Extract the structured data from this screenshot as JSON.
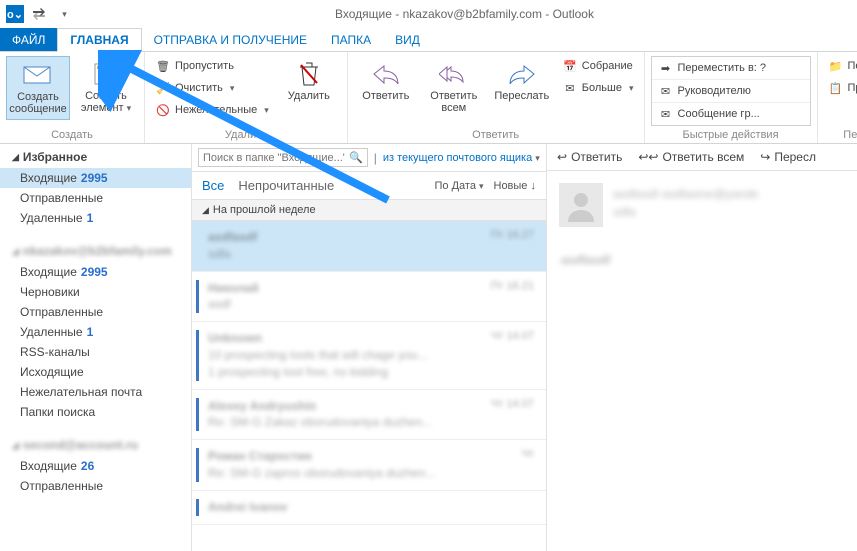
{
  "window": {
    "title": "Входящие - nkazakov@b2bfamily.com - Outlook",
    "app_abbrev": "o⌄"
  },
  "tabs": {
    "file": "ФАЙЛ",
    "home": "ГЛАВНАЯ",
    "sendrecv": "ОТПРАВКА И ПОЛУЧЕНИЕ",
    "folder": "ПАПКА",
    "view": "ВИД"
  },
  "ribbon": {
    "new_group": "Создать",
    "new_mail": "Создать сообщение",
    "new_item": "Создать элемент",
    "ignore": "Пропустить",
    "clean": "Очистить",
    "junk": "Нежелательные",
    "delete": "Удалить",
    "delete_group": "Удалить",
    "reply": "Ответить",
    "reply_all": "Ответить всем",
    "forward": "Переслать",
    "meeting": "Собрание",
    "more": "Больше",
    "respond_group": "Ответить",
    "quick_move": "Переместить в: ?",
    "quick_mgr": "Руководителю",
    "quick_team": "Сообщение гр...",
    "quick_group": "Быстрые действия",
    "move": "Переместить",
    "rules": "Правила",
    "move_group": "Переместить"
  },
  "nav": {
    "favorites": "Избранное",
    "inbox": "Входящие",
    "inbox_count": "2995",
    "sent": "Отправленные",
    "deleted": "Удаленные",
    "deleted_count": "1",
    "acc1": "nkazakov@b2bfamily.com",
    "drafts": "Черновики",
    "rss": "RSS-каналы",
    "outbox": "Исходящие",
    "junk": "Нежелательная почта",
    "search": "Папки поиска",
    "acc2": "second@account.ru",
    "inbox2_count": "26"
  },
  "list": {
    "search_placeholder": "Поиск в папке \"Входящие...\"",
    "scope": "из текущего почтового ящика",
    "all": "Все",
    "unread": "Непрочитанные",
    "sort_by": "По Дата",
    "sort_dir": "Новые",
    "group1": "На прошлой неделе"
  },
  "reading": {
    "reply": "Ответить",
    "reply_all": "Ответить всем",
    "forward": "Пересл"
  }
}
